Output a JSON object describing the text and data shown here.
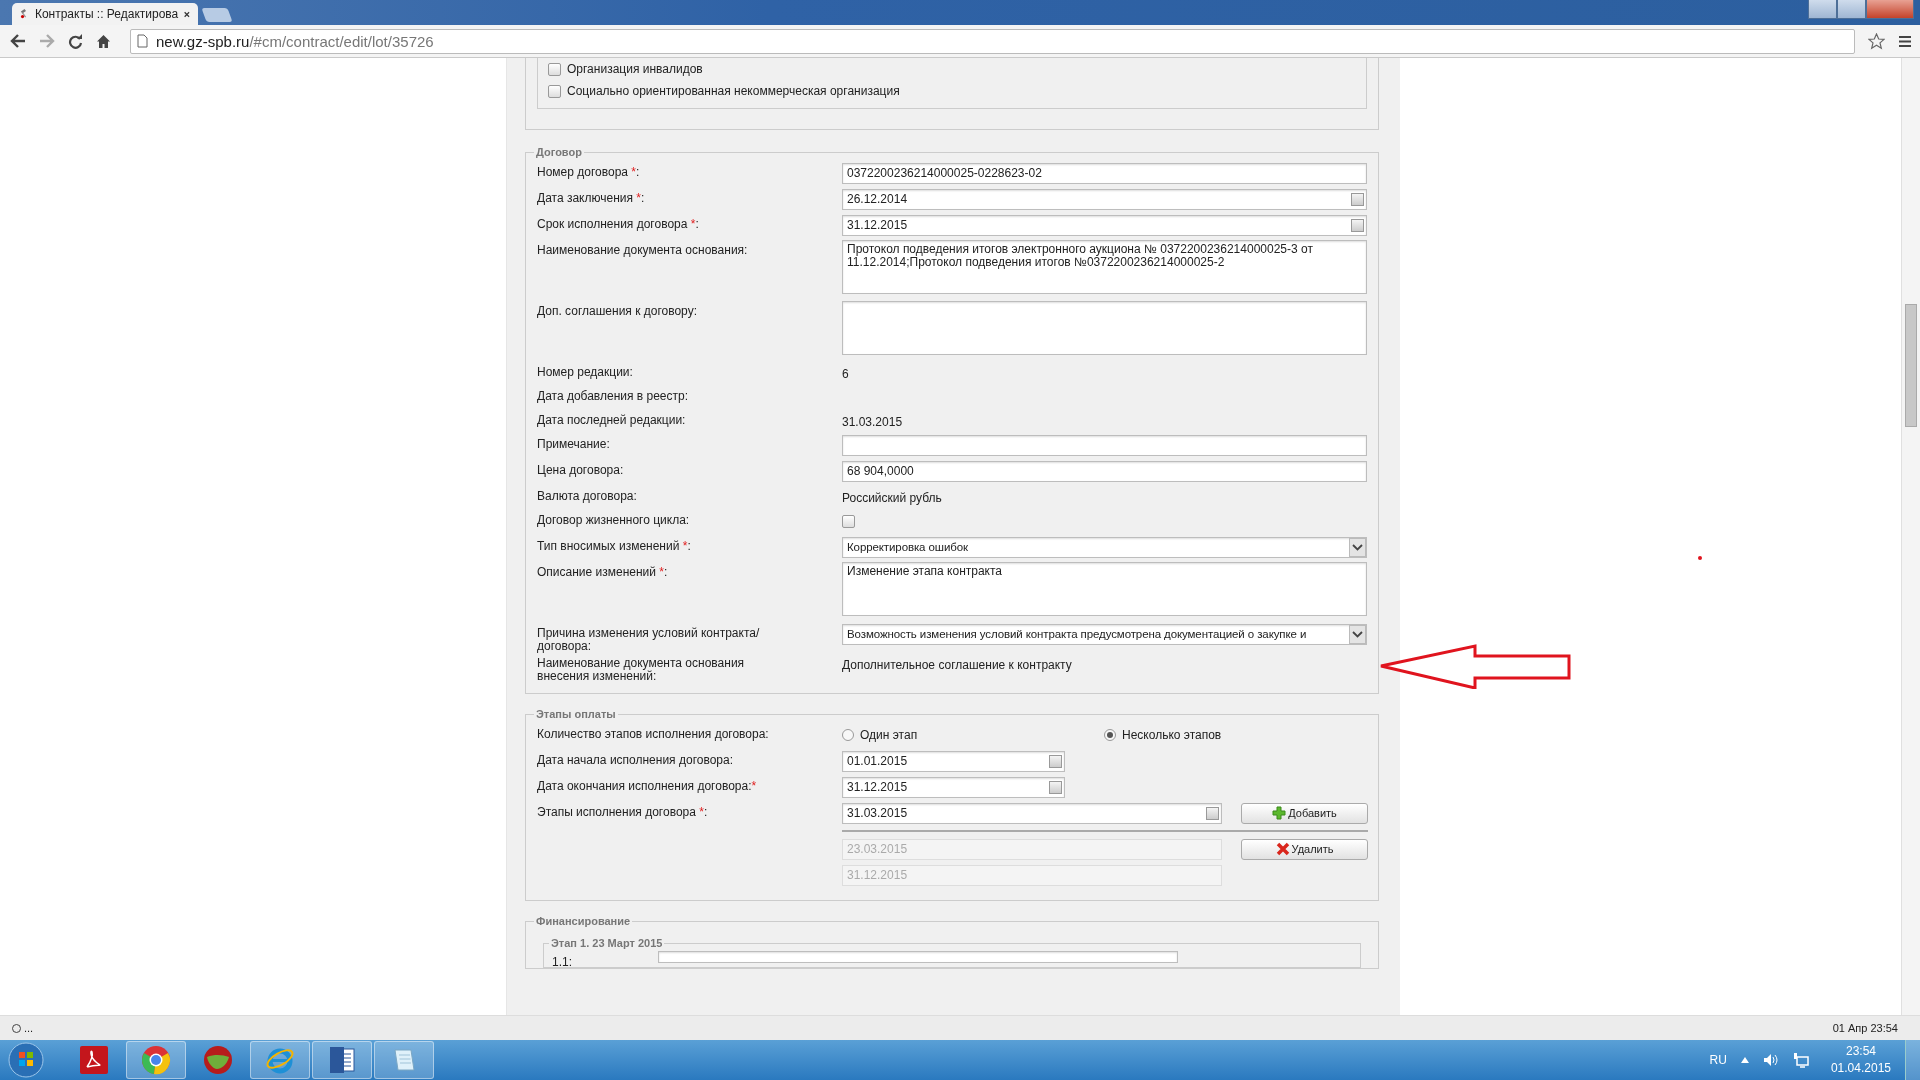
{
  "browser": {
    "tab_title": "Контракты :: Редактирова",
    "url_host": "new.gz-spb.ru",
    "url_path": "/#cm/contract/edit/lot/35726"
  },
  "org_checkboxes": [
    {
      "label": "Организация инвалидов",
      "checked": false
    },
    {
      "label": "Социально ориентированная некоммерческая организация",
      "checked": false
    }
  ],
  "contract": {
    "legend": "Договор",
    "fields": [
      {
        "kind": "input",
        "label": "Номер договора ",
        "mark": "*",
        "suffix": ":",
        "value": "0372200236214000025-0228623-02"
      },
      {
        "kind": "date",
        "label": "Дата заключения ",
        "mark": "*",
        "suffix": ":",
        "value": "26.12.2014"
      },
      {
        "kind": "date",
        "label": "Срок исполнения договора ",
        "mark": "*",
        "suffix": ":",
        "value": "31.12.2015"
      },
      {
        "kind": "textarea",
        "label": "Наименование документа основания:",
        "value": "Протокол подведения итогов электронного аукциона № 0372200236214000025-3 от 11.12.2014;Протокол подведения итогов №0372200236214000025-2"
      },
      {
        "kind": "textarea",
        "label": "Доп. соглашения к договору:"
      },
      {
        "kind": "text",
        "label": "Номер редакции:",
        "value": "6"
      },
      {
        "kind": "text",
        "label": "Дата добавления в реестр:"
      },
      {
        "kind": "text",
        "label": "Дата последней редакции:",
        "value": "31.03.2015"
      },
      {
        "kind": "input",
        "label": "Примечание:"
      },
      {
        "kind": "input",
        "label": "Цена договора:",
        "value": "68 904,0000"
      },
      {
        "kind": "text",
        "label": "Валюта договора:",
        "value": "Российский рубль"
      },
      {
        "kind": "checkbox",
        "label": "Договор жизненного цикла:",
        "checked": false
      },
      {
        "kind": "select",
        "label": "Тип вносимых изменений ",
        "mark": "*",
        "suffix": ":",
        "value": "Корректировка ошибок"
      },
      {
        "kind": "textarea",
        "label": "Описание изменений ",
        "mark": "*",
        "suffix": ":",
        "value": "Изменение этапа контракта"
      },
      {
        "kind": "select",
        "label": "Причина изменения условий контракта/договора:",
        "value": "Возможность изменения условий контракта предусмотрена документацией о закупке и"
      },
      {
        "kind": "text",
        "label": "Наименование документа основания внесения изменений:",
        "value": "Дополнительное соглашение к контракту"
      }
    ]
  },
  "payments": {
    "legend": "Этапы оплаты",
    "count_label": "Количество этапов исполнения договора:",
    "count_options": [
      {
        "label": "Один этап",
        "selected": false
      },
      {
        "label": "Несколько этапов",
        "selected": true
      }
    ],
    "dates": [
      {
        "label": "Дата начала исполнения договора:",
        "value": "01.01.2015"
      },
      {
        "label": "Дата окончания исполнения договора:",
        "mark": "*",
        "value": "31.12.2015"
      }
    ],
    "stages_label": "Этапы исполнения договора ",
    "stages_mark": "*",
    "stages_suffix": ":",
    "stage_input": "31.03.2015",
    "add_button": "Добавить",
    "stages": [
      "23.03.2015",
      "31.12.2015"
    ],
    "delete_button": "Удалить"
  },
  "financing": {
    "legend": "Финансирование",
    "stage_legend": "Этап 1. 23 Март 2015",
    "row_label": "1.1:"
  },
  "status_bar": {
    "left": "...",
    "right": "01 Апр 23:54"
  },
  "taskbar": {
    "language": "RU",
    "time": "23:54",
    "date": "01.04.2015"
  }
}
